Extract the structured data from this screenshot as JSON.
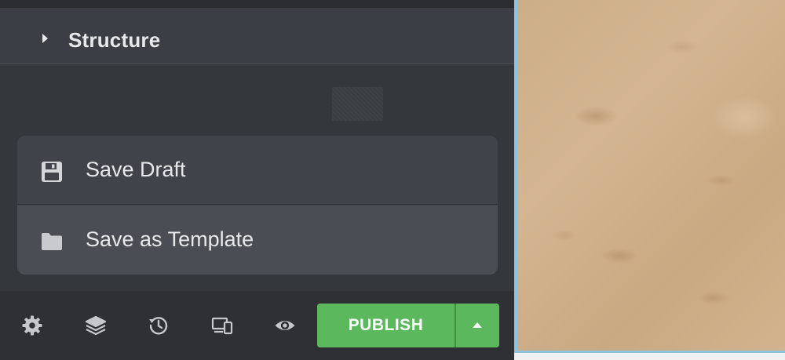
{
  "panel": {
    "section_title": "Structure"
  },
  "menu": {
    "items": [
      {
        "label": "Save Draft",
        "icon": "floppy-disk-icon"
      },
      {
        "label": "Save as Template",
        "icon": "folder-icon"
      }
    ]
  },
  "toolbar": {
    "icons": [
      "gear-icon",
      "layers-icon",
      "history-icon",
      "responsive-devices-icon",
      "eye-icon"
    ],
    "publish_label": "PUBLISH",
    "publish_color": "#5cb85c"
  },
  "colors": {
    "panel_bg": "#34373c",
    "menu_bg": "#404349",
    "text": "#e6e8ea",
    "canvas_accent": "#8cc4e0"
  }
}
